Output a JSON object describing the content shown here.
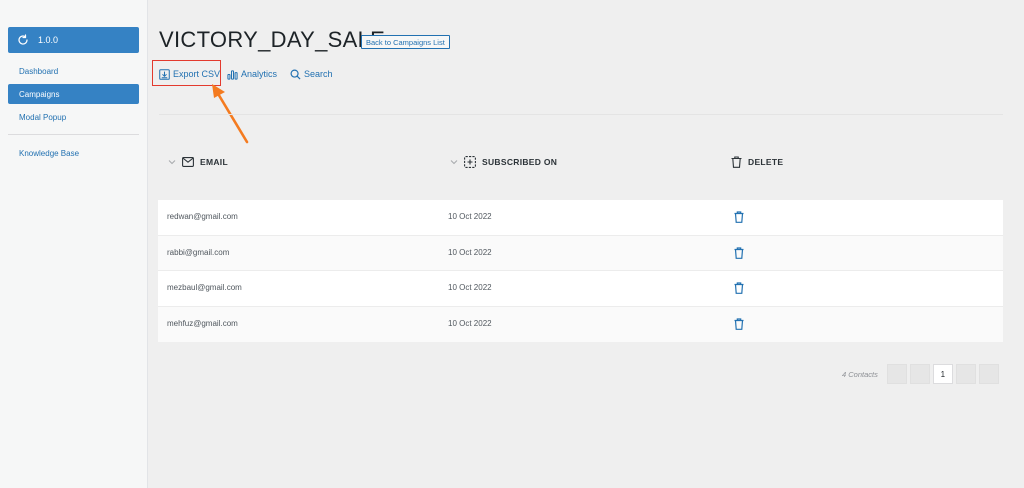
{
  "sidebar": {
    "version_label": "1.0.0",
    "items": [
      {
        "label": "Dashboard"
      },
      {
        "label": "Campaigns"
      },
      {
        "label": "Modal Popup"
      },
      {
        "label": "Knowledge Base"
      }
    ]
  },
  "header": {
    "title": "VICTORY_DAY_SALE",
    "back_label": "Back to Campaigns List"
  },
  "toolbar": {
    "export_label": "Export CSV",
    "analytics_label": "Analytics",
    "search_label": "Search"
  },
  "table": {
    "columns": [
      "EMAIL",
      "SUBSCRIBED ON",
      "DELETE"
    ],
    "rows": [
      {
        "email": "redwan@gmail.com",
        "date": "10 Oct 2022"
      },
      {
        "email": "rabbi@gmail.com",
        "date": "10 Oct 2022"
      },
      {
        "email": "mezbaul@gmail.com",
        "date": "10 Oct 2022"
      },
      {
        "email": "mehfuz@gmail.com",
        "date": "10 Oct 2022"
      }
    ]
  },
  "pagination": {
    "contacts_label": "4 Contacts",
    "current_page": "1"
  },
  "colors": {
    "accent": "#3582c4",
    "link": "#2271b1",
    "highlight": "#e33a2e",
    "arrow": "#f47b20"
  }
}
